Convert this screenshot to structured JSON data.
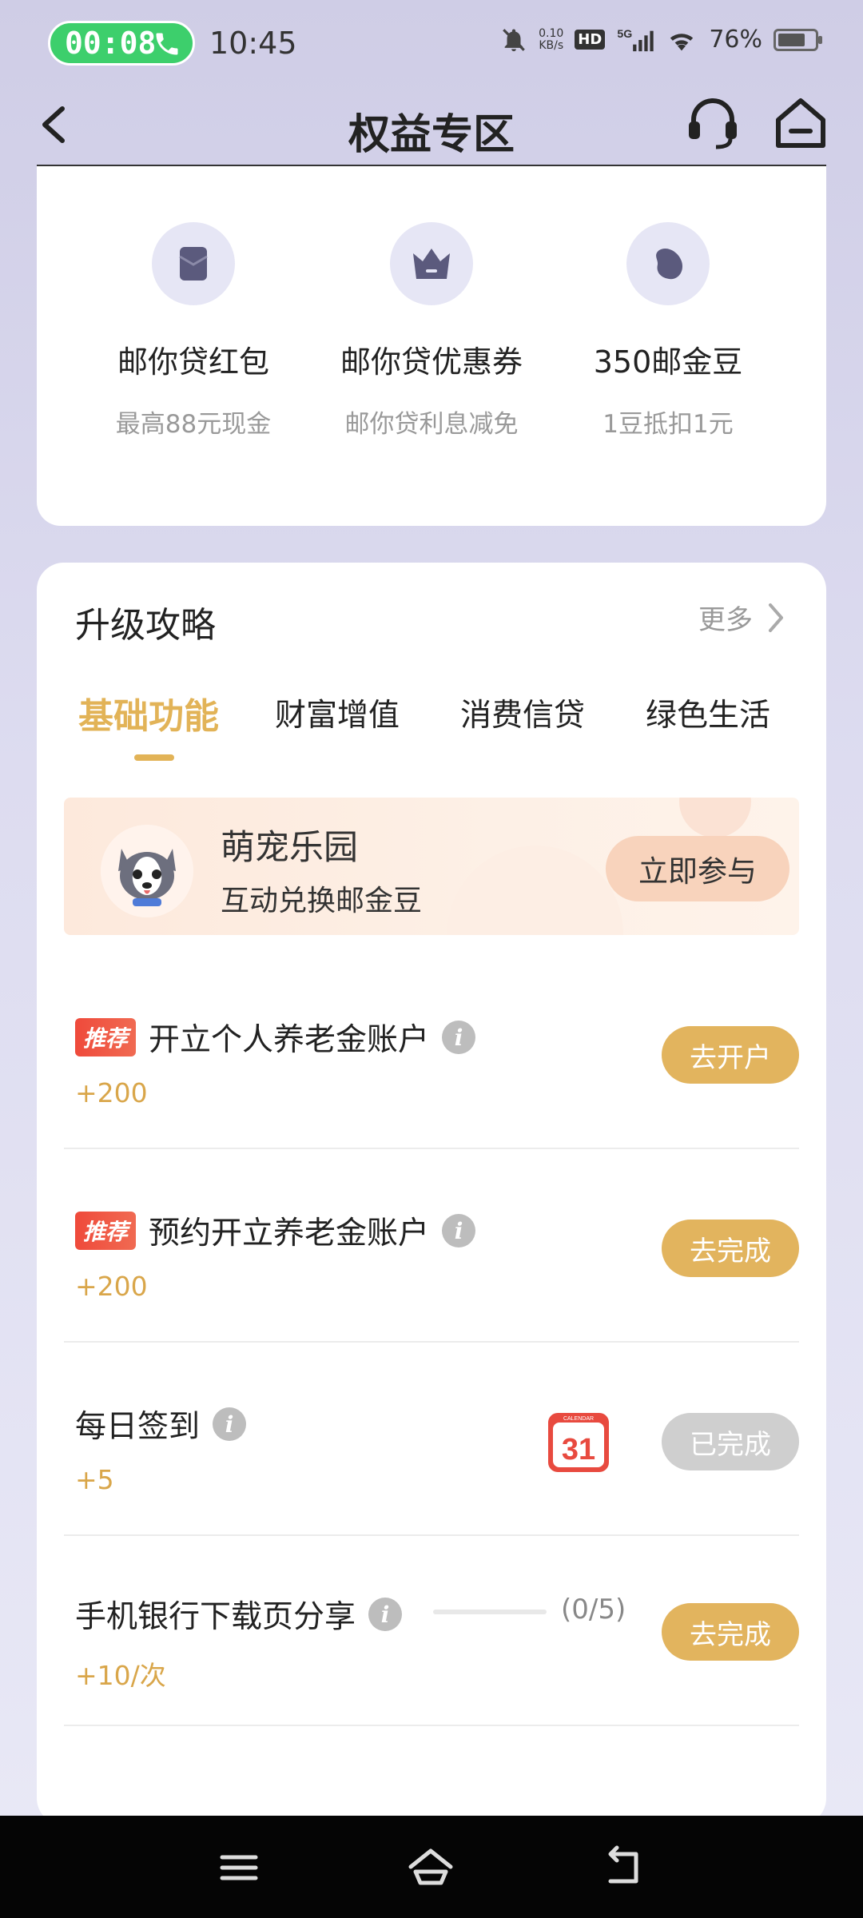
{
  "status_bar": {
    "call_timer": "00:08",
    "time": "10:45",
    "net_speed": "0.10\nKB/s",
    "hd": "HD",
    "signal": "5G",
    "battery": "76%",
    "battery_level": 0.76
  },
  "header": {
    "title": "权益专区"
  },
  "benefits": [
    {
      "name": "邮你贷红包",
      "desc": "最高88元现金",
      "icon": "red-envelope-icon"
    },
    {
      "name": "邮你贷优惠券",
      "desc": "邮你贷利息减免",
      "icon": "crown-icon"
    },
    {
      "name": "350邮金豆",
      "desc": "1豆抵扣1元",
      "icon": "bean-icon"
    }
  ],
  "section": {
    "title": "升级攻略",
    "more": "更多"
  },
  "tabs": [
    {
      "label": "基础功能",
      "active": true
    },
    {
      "label": "财富增值",
      "active": false
    },
    {
      "label": "消费信贷",
      "active": false
    },
    {
      "label": "绿色生活",
      "active": false
    }
  ],
  "banner": {
    "title": "萌宠乐园",
    "subtitle": "互动兑换邮金豆",
    "button": "立即参与"
  },
  "tasks": [
    {
      "badge": "推荐",
      "title": "开立个人养老金账户",
      "reward": "+200",
      "button": "去开户"
    },
    {
      "badge": "推荐",
      "title": "预约开立养老金账户",
      "reward": "+200",
      "button": "去完成"
    },
    {
      "title": "每日签到",
      "reward": "+5",
      "button": "已完成",
      "calendar_label": "CALENDAR",
      "calendar_day": "31"
    },
    {
      "title": "手机银行下载页分享",
      "reward": "+10/次",
      "button": "去完成",
      "progress_text": "(0/5)",
      "progress": 0
    }
  ],
  "colors": {
    "accent_gold": "#e2b45e",
    "badge_red": "#ef4a3b",
    "background": "#d9d8ee"
  }
}
